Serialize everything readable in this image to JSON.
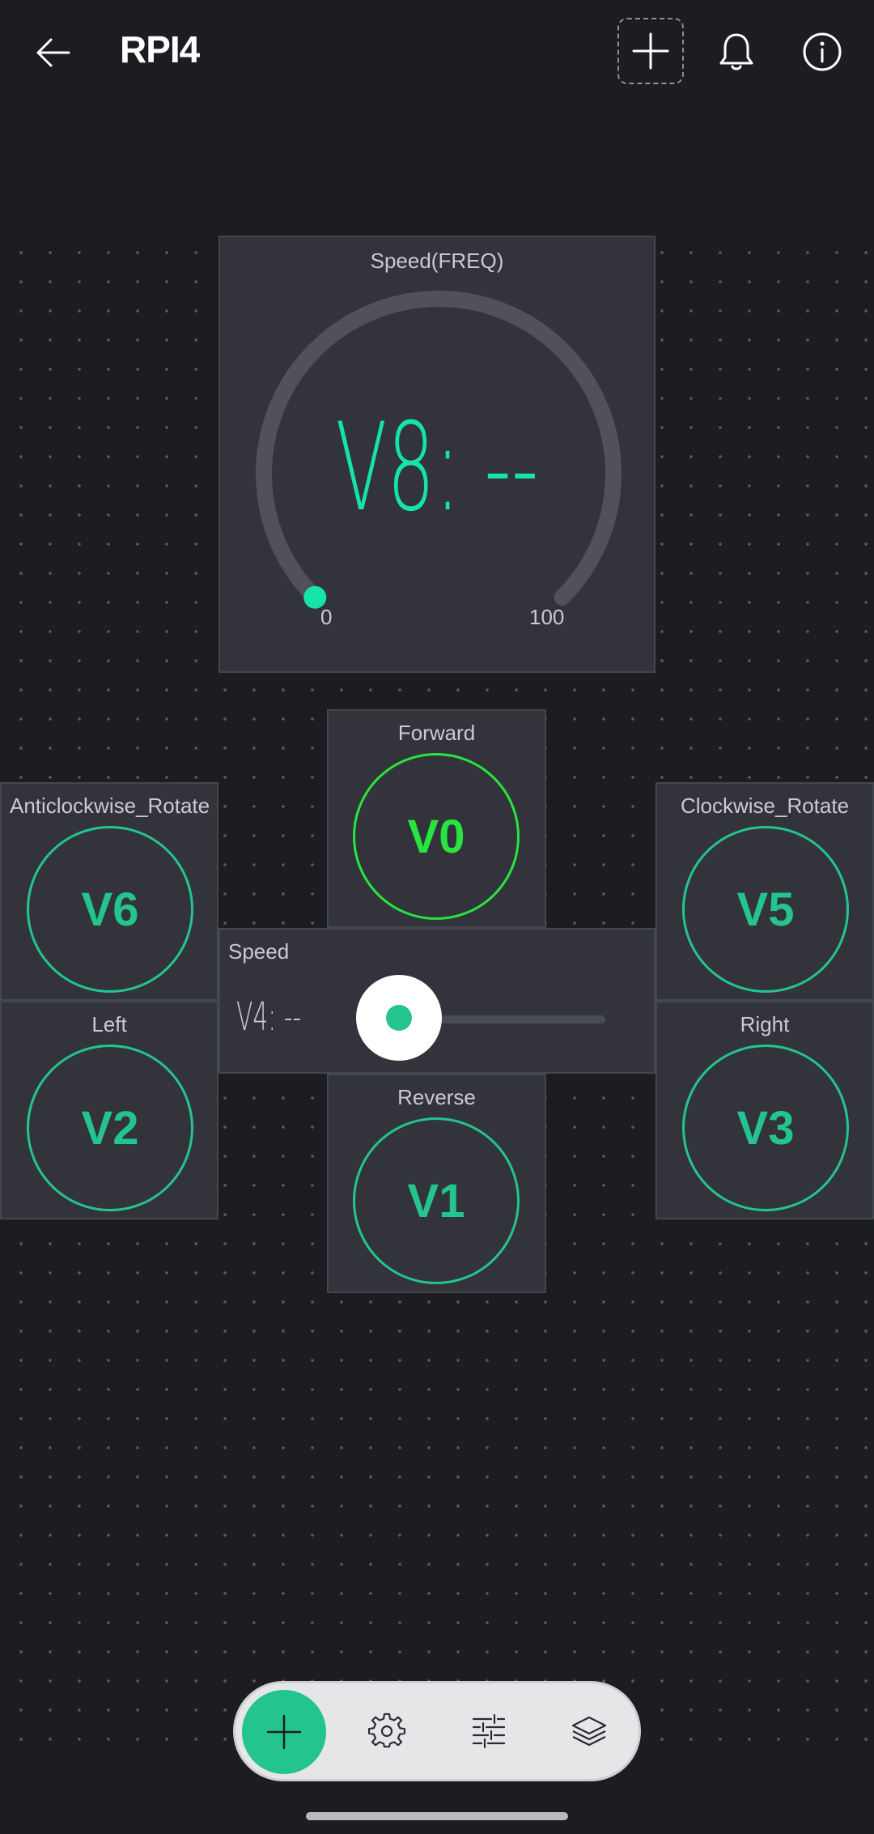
{
  "header": {
    "title": "RPI4",
    "icons": [
      "arrow-left-icon",
      "plus-icon",
      "bell-icon",
      "info-icon"
    ]
  },
  "colors": {
    "background": "#1c1d21",
    "widget": "#33343b",
    "accent": "#23c48e",
    "active": "#27e43e",
    "gauge_text": "#14e5a6"
  },
  "gauge": {
    "label": "Speed(FREQ)",
    "value_text": "V8: --",
    "min": "0",
    "max": "100",
    "level": 0
  },
  "buttons": {
    "forward": {
      "label": "Forward",
      "pin": "V0"
    },
    "anticlockwise": {
      "label": "Anticlockwise_Rotate",
      "pin": "V6"
    },
    "clockwise": {
      "label": "Clockwise_Rotate",
      "pin": "V5"
    },
    "left": {
      "label": "Left",
      "pin": "V2"
    },
    "right": {
      "label": "Right",
      "pin": "V3"
    },
    "reverse": {
      "label": "Reverse",
      "pin": "V1"
    }
  },
  "slider": {
    "label": "Speed",
    "value_text": "V4: --",
    "level": 0
  },
  "toolbar": {
    "icons": [
      "plus-icon",
      "gear-icon",
      "sliders-icon",
      "layers-icon"
    ]
  }
}
